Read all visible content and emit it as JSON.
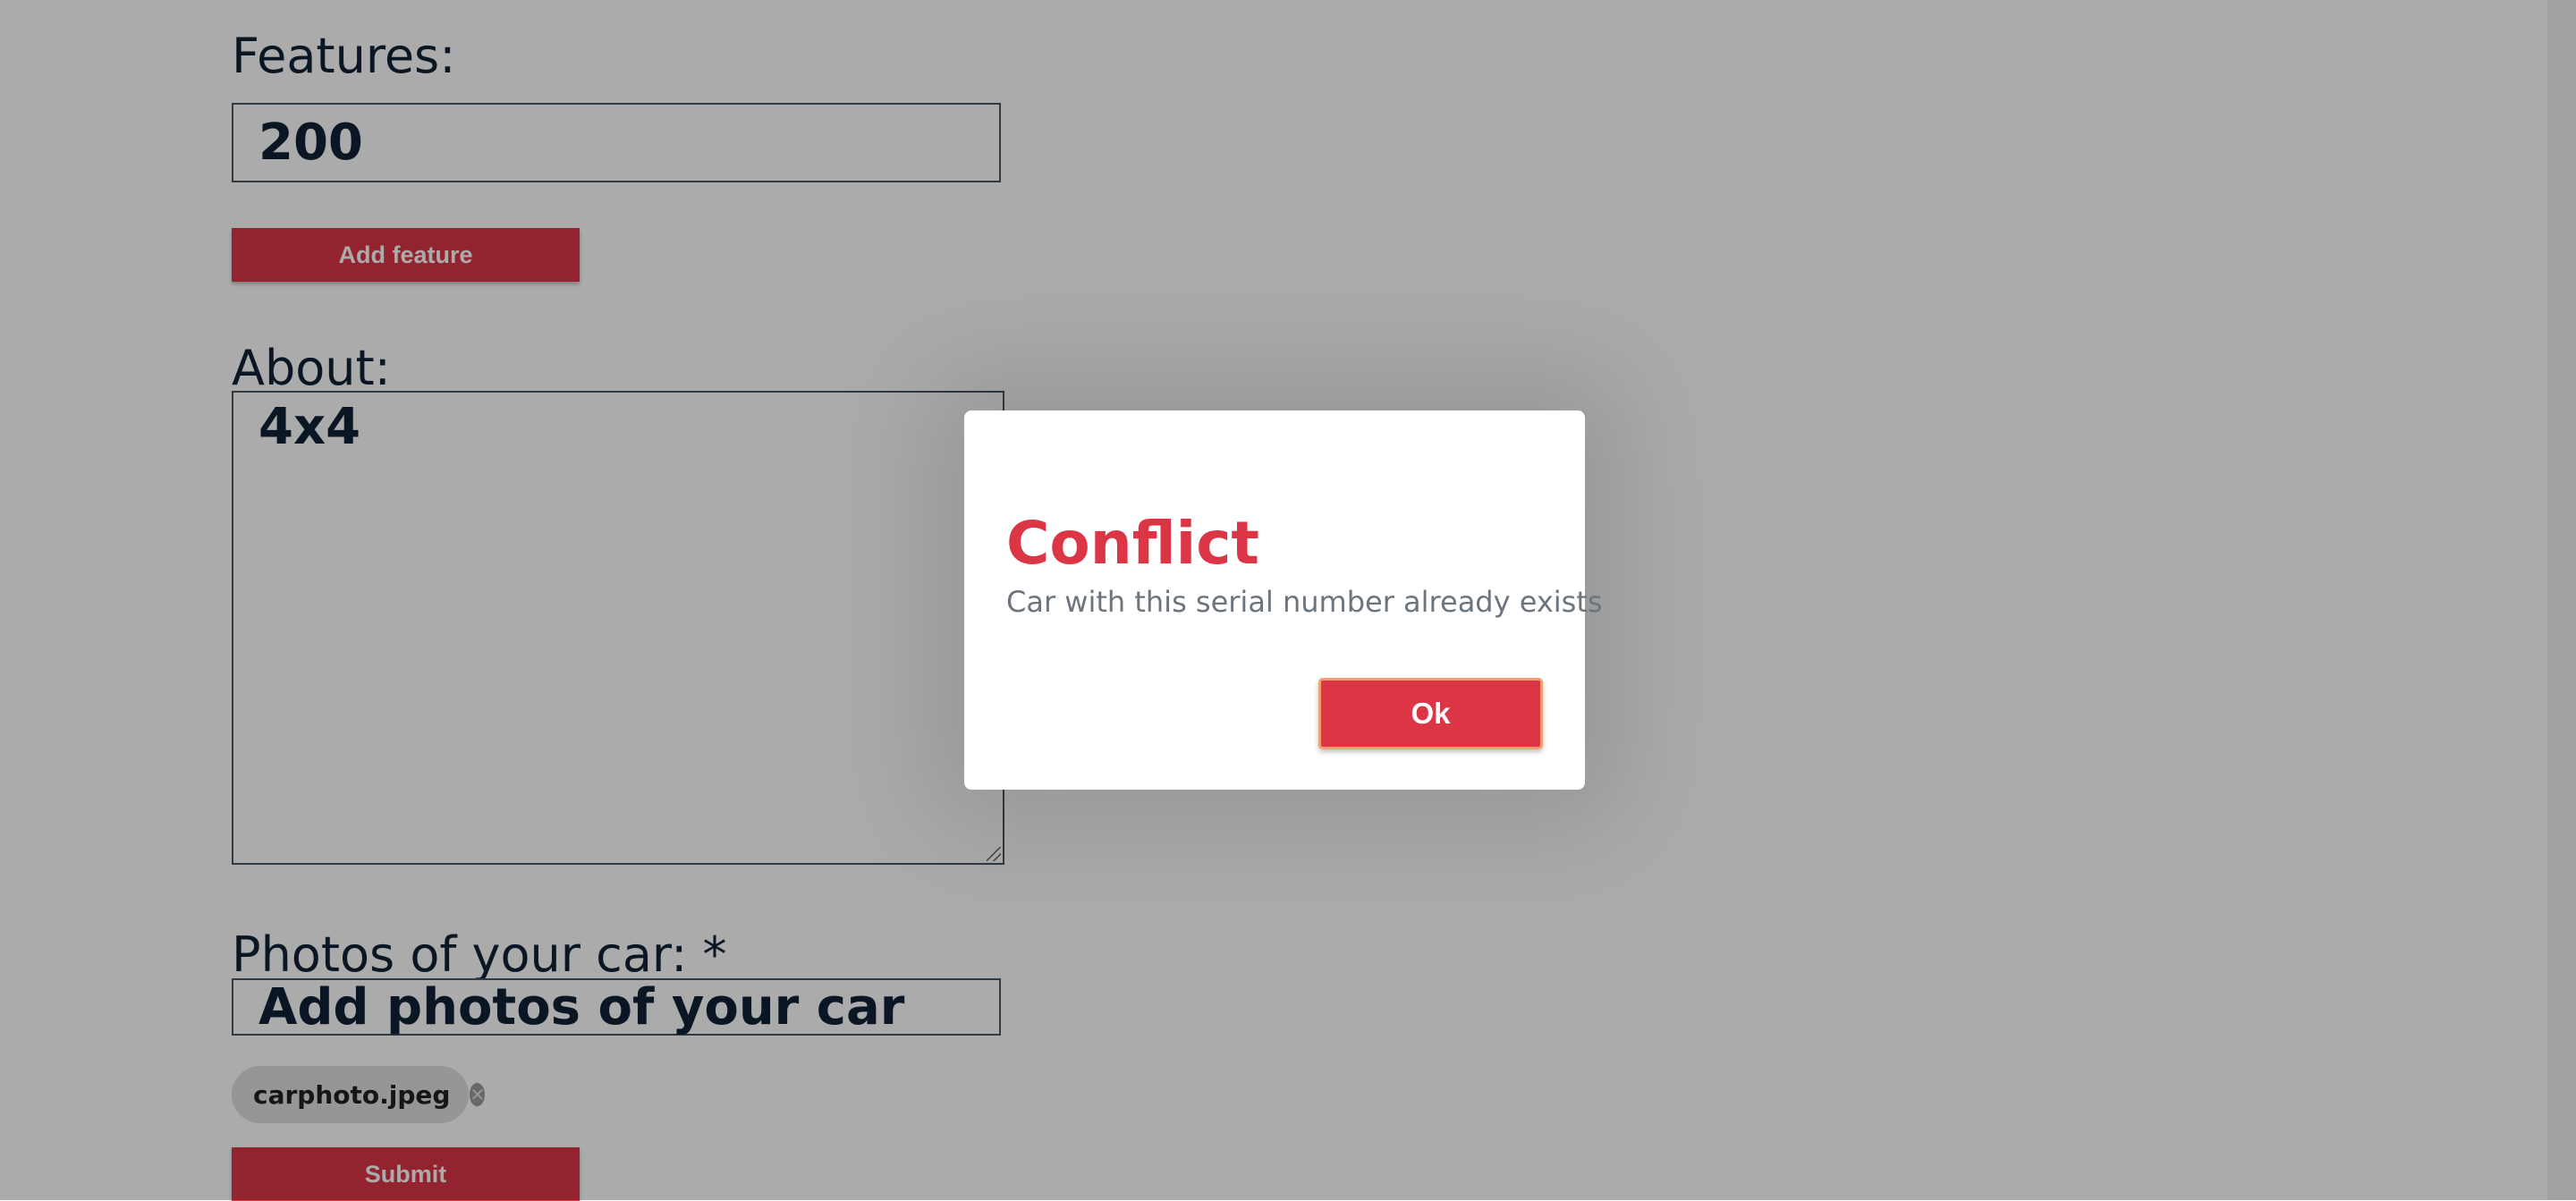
{
  "form": {
    "features_label": "Features:",
    "features_value": "200",
    "add_feature_label": "Add feature",
    "about_label": "About:",
    "about_value": "4x4",
    "photos_label": "Photos of your car: *",
    "photos_placeholder": "Add photos of your car",
    "photo_chips": [
      {
        "filename": "carphoto.jpeg"
      }
    ],
    "submit_label": "Submit"
  },
  "dialog": {
    "title": "Conflict",
    "message": "Car with this serial number already exists",
    "ok_label": "Ok"
  },
  "colors": {
    "accent": "#dc3545",
    "label_text": "#102136",
    "message_text": "#6c757d"
  }
}
